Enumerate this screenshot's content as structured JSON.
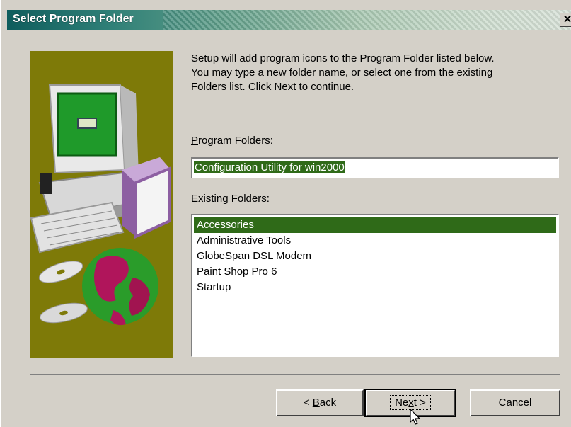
{
  "window": {
    "title": "Select Program Folder",
    "close_glyph": "✕"
  },
  "intro": {
    "lines": [
      "Setup will add program icons to the Program Folder listed below.",
      "You may type a new folder name, or select one from the existing",
      "Folders list.  Click Next to continue."
    ]
  },
  "program_folders": {
    "label_prefix": "",
    "label_accel": "P",
    "label_rest": "rogram Folders:",
    "value": "Configuration Utility for win2000"
  },
  "existing_folders": {
    "label_prefix": "E",
    "label_accel": "x",
    "label_rest": "isting Folders:",
    "items": [
      "Accessories",
      "Administrative Tools",
      "GlobeSpan DSL Modem",
      "Paint Shop Pro 6",
      "Startup"
    ],
    "selected_index": 0
  },
  "buttons": {
    "back_prefix": "< ",
    "back_accel": "B",
    "back_rest": "ack",
    "next_prefix": "Ne",
    "next_accel": "x",
    "next_rest": "t >",
    "cancel": "Cancel"
  },
  "colors": {
    "selection": "#2f6a18",
    "art_background": "#7e7a08",
    "dialog_face": "#d4d0c8"
  }
}
